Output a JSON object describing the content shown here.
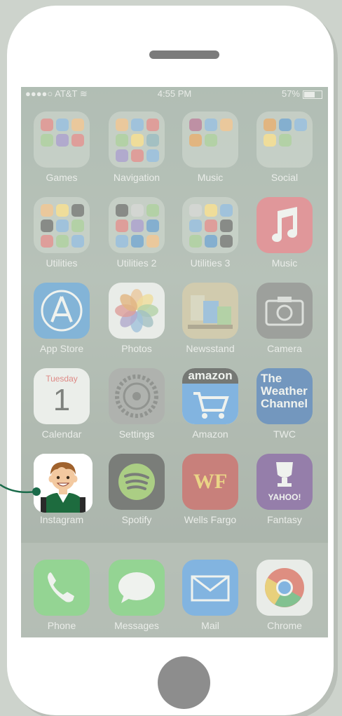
{
  "status_bar": {
    "carrier": "AT&T",
    "time": "4:55 PM",
    "battery": "57%"
  },
  "apps": [
    {
      "label": "Games",
      "type": "folder",
      "colors": [
        "#e06666",
        "#6fa8dc",
        "#f6b26b",
        "#93c47d",
        "#8e7cc3",
        "#e06666"
      ]
    },
    {
      "label": "Navigation",
      "type": "folder",
      "colors": [
        "#f6b26b",
        "#6fa8dc",
        "#e06666",
        "#93c47d",
        "#ffd966",
        "#76a5af",
        "#8e7cc3",
        "#e06666",
        "#6fa8dc"
      ]
    },
    {
      "label": "Music",
      "type": "folder",
      "colors": [
        "#a64d79",
        "#6fa8dc",
        "#f6b26b",
        "#e69138",
        "#93c47d"
      ]
    },
    {
      "label": "Social",
      "type": "folder",
      "colors": [
        "#e69138",
        "#3d85c6",
        "#6fa8dc",
        "#ffd966",
        "#93c47d"
      ]
    },
    {
      "label": "Utilities",
      "type": "folder",
      "colors": [
        "#f6b26b",
        "#ffd966",
        "#444444",
        "#444444",
        "#6fa8dc",
        "#93c47d",
        "#e06666",
        "#93c47d",
        "#6fa8dc"
      ]
    },
    {
      "label": "Utilities 2",
      "type": "folder",
      "colors": [
        "#444444",
        "#cccccc",
        "#93c47d",
        "#e06666",
        "#8e7cc3",
        "#3d85c6",
        "#6fa8dc",
        "#3d85c6",
        "#f6b26b"
      ]
    },
    {
      "label": "Utilities 3",
      "type": "folder",
      "colors": [
        "#cccccc",
        "#ffd966",
        "#6fa8dc",
        "#6fa8dc",
        "#e06666",
        "#444444",
        "#93c47d",
        "#3d85c6",
        "#444444"
      ]
    },
    {
      "label": "Music",
      "type": "music",
      "colors": [
        "#e35a67"
      ]
    },
    {
      "label": "App Store",
      "type": "appstore",
      "colors": [
        "#3b8fd6"
      ]
    },
    {
      "label": "Photos",
      "type": "photos",
      "colors": [
        "#f4f4f4"
      ]
    },
    {
      "label": "Newsstand",
      "type": "newsstand",
      "colors": [
        "#c9b98a"
      ]
    },
    {
      "label": "Camera",
      "type": "camera",
      "colors": [
        "#6b6b6b"
      ]
    },
    {
      "label": "Calendar",
      "type": "calendar",
      "colors": [
        "#f7f7f7"
      ],
      "day_name": "Tuesday",
      "day_number": "1"
    },
    {
      "label": "Settings",
      "type": "settings",
      "colors": [
        "#8a8a8a"
      ]
    },
    {
      "label": "Amazon",
      "type": "amazon",
      "colors": [
        "#f7f7f7"
      ],
      "wordmark": "amazon"
    },
    {
      "label": "TWC",
      "type": "twc",
      "colors": [
        "#1e5aa8"
      ],
      "text": [
        "The",
        "Weather",
        "Channel"
      ]
    },
    {
      "label": "Instagram",
      "type": "placeholder",
      "colors": [
        "#ffffff"
      ]
    },
    {
      "label": "Spotify",
      "type": "spotify",
      "colors": [
        "#2a2a2a"
      ]
    },
    {
      "label": "Wells Fargo",
      "type": "wellsfargo",
      "colors": [
        "#b8312f"
      ],
      "text": "WF"
    },
    {
      "label": "Fantasy",
      "type": "fantasy",
      "colors": [
        "#5b2c83"
      ],
      "text": "YAHOO!"
    }
  ],
  "dock": [
    {
      "label": "Phone",
      "type": "phone",
      "colors": [
        "#5ac85a"
      ]
    },
    {
      "label": "Messages",
      "type": "messages",
      "colors": [
        "#5ac85a"
      ]
    },
    {
      "label": "Mail",
      "type": "mail",
      "colors": [
        "#3a8ee6"
      ]
    },
    {
      "label": "Chrome",
      "type": "chrome",
      "colors": [
        "#f4f4f4"
      ]
    }
  ],
  "colors": {
    "accent_green": "#1a6b4a",
    "avatar_jacket": "#1d6b3e",
    "avatar_hair": "#a0622d",
    "avatar_skin": "#f3c9a0"
  }
}
